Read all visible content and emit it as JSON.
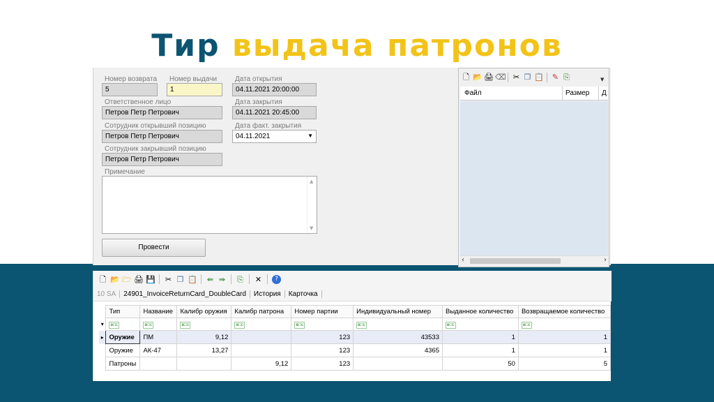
{
  "slide": {
    "title_part1": "Тир",
    "title_part2": "выдача патронов",
    "colors": {
      "band": "#0b5472",
      "title_dark": "#0b5472",
      "title_yellow": "#f2c318"
    }
  },
  "form": {
    "return_no_label": "Номер возврата",
    "return_no_value": "5",
    "issue_no_label": "Номер выдачи",
    "issue_no_value": "1",
    "open_date_label": "Дата открытия",
    "open_date_value": "04.11.2021 20:00:00",
    "responsible_label": "Ответственное лицо",
    "responsible_value": "Петров Петр Петрович",
    "close_date_label": "Дата закрытия",
    "close_date_value": "04.11.2021 20:45:00",
    "opened_by_label": "Сотрудник открывший позицию",
    "opened_by_value": "Петров Петр Петрович",
    "actual_close_label": "Дата факт. закрытия",
    "actual_close_value": "04.11.2021",
    "closed_by_label": "Сотрудник закрывший позицию",
    "closed_by_value": "Петров Петр Петрович",
    "note_label": "Примечание",
    "note_value": "",
    "submit_label": "Провести"
  },
  "file_panel": {
    "toolbar_icons": [
      "new-icon",
      "open-icon",
      "print-icon",
      "eraser-icon",
      "cut-icon",
      "copy-icon",
      "paste-icon",
      "edit-icon",
      "export-icon"
    ],
    "col_file": "Файл",
    "col_size": "Размер",
    "col_date": "Д"
  },
  "grid": {
    "toolbar_icons": [
      "new-icon",
      "open-icon",
      "open-folder-icon",
      "print-icon",
      "save-icon",
      "cut-icon",
      "copy-icon",
      "paste-icon",
      "back-icon",
      "forward-icon",
      "export-icon",
      "delete-icon",
      "help-icon"
    ],
    "tabs": [
      "10 SA",
      "24901_InvoiceReturnCard_DoubleCard",
      "История",
      "Карточка"
    ],
    "filter_icon_text": "ᴃ□c",
    "columns": [
      "Тип",
      "Название",
      "Калибр оружия",
      "Калибр патрона",
      "Номер партии",
      "Индивидуальный номер",
      "Выданное количество",
      "Возвращаемое количество"
    ],
    "rows": [
      {
        "type": "Оружие",
        "name": "ПМ",
        "weapon_cal": "9,12",
        "ammo_cal": "",
        "batch": "123",
        "ind_no": "43533",
        "issued": "1",
        "returned": "1"
      },
      {
        "type": "Оружие",
        "name": "АК-47",
        "weapon_cal": "13,27",
        "ammo_cal": "",
        "batch": "123",
        "ind_no": "4365",
        "issued": "1",
        "returned": "1"
      },
      {
        "type": "Патроны",
        "name": "",
        "weapon_cal": "",
        "ammo_cal": "9,12",
        "batch": "123",
        "ind_no": "",
        "issued": "50",
        "returned": "5"
      }
    ]
  }
}
